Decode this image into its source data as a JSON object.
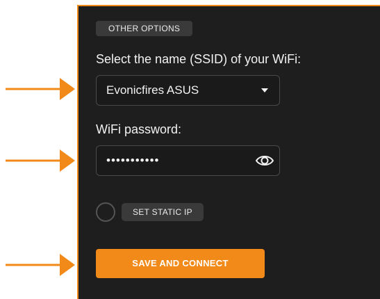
{
  "colors": {
    "accent": "#f28a1a",
    "panel_bg": "#1e1e1e",
    "chip_bg": "#3a3a3a"
  },
  "other_options_label": "OTHER OPTIONS",
  "ssid": {
    "label": "Select the name (SSID) of your WiFi:",
    "selected_value": "Evonicfires ASUS",
    "dropdown_icon": "caret-down-icon"
  },
  "password": {
    "label": "WiFi password:",
    "masked_value": "•••••••••••",
    "toggle_icon": "eye-icon"
  },
  "static_ip": {
    "label": "SET STATIC IP",
    "enabled": false
  },
  "save_button_label": "SAVE AND CONNECT",
  "annotations": {
    "arrow_icon": "arrow-right-icon"
  }
}
